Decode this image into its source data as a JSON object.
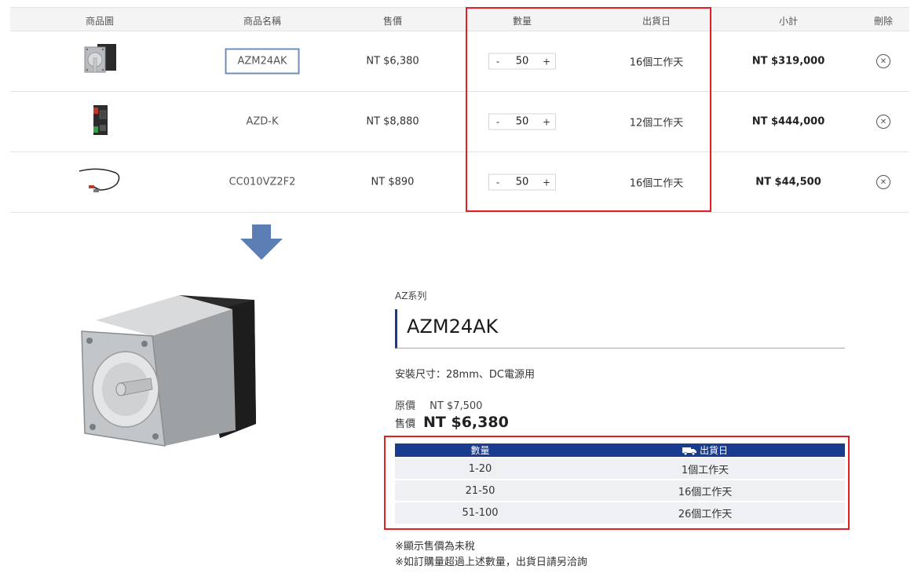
{
  "cart": {
    "headers": {
      "image": "商品圖",
      "name": "商品名稱",
      "price": "售價",
      "quantity": "數量",
      "ship_date": "出貨日",
      "subtotal": "小計",
      "delete": "刪除"
    },
    "rows": [
      {
        "name": "AZM24AK",
        "price": "NT $6,380",
        "qty_minus": "-",
        "qty": "50",
        "qty_plus": "+",
        "ship": "16個工作天",
        "subtotal": "NT $319,000",
        "delete_icon": "✕",
        "image_icon": "stepper-motor-image"
      },
      {
        "name": "AZD-K",
        "price": "NT $8,880",
        "qty_minus": "-",
        "qty": "50",
        "qty_plus": "+",
        "ship": "12個工作天",
        "subtotal": "NT $444,000",
        "delete_icon": "✕",
        "image_icon": "driver-unit-image"
      },
      {
        "name": "CC010VZ2F2",
        "price": "NT $890",
        "qty_minus": "-",
        "qty": "50",
        "qty_plus": "+",
        "ship": "16個工作天",
        "subtotal": "NT $44,500",
        "delete_icon": "✕",
        "image_icon": "cable-image"
      }
    ]
  },
  "product": {
    "series": "AZ系列",
    "title": "AZM24AK",
    "spec": "安裝尺寸：28mm、DC電源用",
    "original_label": "原價",
    "original_price": "NT $7,500",
    "sale_label": "售價",
    "sale_price": "NT $6,380",
    "lead_table": {
      "headers": {
        "quantity": "數量",
        "ship": "出貨日"
      },
      "rows": [
        {
          "quantity": "1-20",
          "ship": "1個工作天"
        },
        {
          "quantity": "21-50",
          "ship": "16個工作天"
        },
        {
          "quantity": "51-100",
          "ship": "26個工作天"
        }
      ]
    },
    "notes": [
      "※顯示售價為未稅",
      "※如訂購量超過上述數量，出貨日請另洽詢"
    ]
  },
  "colors": {
    "accent_blue": "#1a3c8e",
    "highlight_red": "#e51e25",
    "arrow_blue": "#5b7fb5"
  }
}
